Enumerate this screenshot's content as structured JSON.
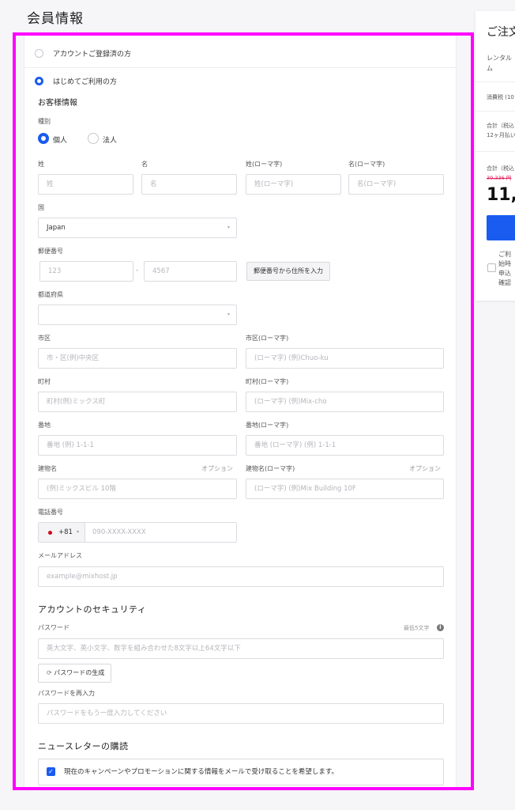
{
  "page_title": "会員情報",
  "account_options": {
    "registered": "アカウントご登録済の方",
    "first_time": "はじめてご利用の方"
  },
  "customer_section": "お客様情報",
  "type": {
    "label": "種別",
    "individual": "個人",
    "corporate": "法人",
    "selected": "個人"
  },
  "name": {
    "last_label": "姓",
    "last_placeholder": "姓",
    "first_label": "名",
    "first_placeholder": "名",
    "last_roman_label": "姓(ローマ字)",
    "last_roman_placeholder": "姓(ローマ字)",
    "first_roman_label": "名(ローマ字)",
    "first_roman_placeholder": "名(ローマ字)"
  },
  "country": {
    "label": "国",
    "value": "Japan"
  },
  "postal": {
    "label": "郵便番号",
    "part1_placeholder": "123",
    "separator": "-",
    "part2_placeholder": "4567",
    "lookup_button": "郵便番号から住所を入力"
  },
  "prefecture": {
    "label": "都道府県",
    "value": ""
  },
  "city": {
    "label": "市区",
    "placeholder": "市・区(例)中央区",
    "roman_label": "市区(ローマ字)",
    "roman_placeholder": "(ローマ字) (例)Chuo-ku"
  },
  "town": {
    "label": "町村",
    "placeholder": "町村(例)ミックス町",
    "roman_label": "町村(ローマ字)",
    "roman_placeholder": "(ローマ字) (例)Mix-cho"
  },
  "block": {
    "label": "番地",
    "placeholder": "番地 (例) 1-1-1",
    "roman_label": "番地(ローマ字)",
    "roman_placeholder": "番地 (ローマ字) (例) 1-1-1"
  },
  "building": {
    "label": "建物名",
    "optional": "オプション",
    "placeholder": "(例)ミックスビル 10階",
    "roman_label": "建物名(ローマ字)",
    "roman_optional": "オプション",
    "roman_placeholder": "(ローマ字) (例)Mix Building 10F"
  },
  "phone": {
    "label": "電話番号",
    "code": "+81",
    "placeholder": "090-XXXX-XXXX"
  },
  "email": {
    "label": "メールアドレス",
    "placeholder": "example@mixhost.jp"
  },
  "security": {
    "title": "アカウントのセキュリティ",
    "password_label": "パスワード",
    "min_hint": "最低5文字",
    "password_placeholder": "英大文字、英小文字、数字を組み合わせた8文字以上64文字以下",
    "generate_button": "パスワードの生成",
    "confirm_label": "パスワードを再入力",
    "confirm_placeholder": "パスワードをもう一度入力してください"
  },
  "newsletter": {
    "title": "ニュースレターの購読",
    "checkbox_label": "現在のキャンペーンやプロモーションに関する情報をメールで受け取ることを希望します。",
    "checked": true
  },
  "order": {
    "title": "ご注文",
    "rental_line1": "レンタル",
    "rental_line2": "ム",
    "tax": "消費税 (10",
    "total1": "合計（税込",
    "monthly": "12ヶ月払い",
    "total2": "合計（税込",
    "old_price": "39,336 円",
    "price": "11,",
    "note1": "ご利",
    "note2": "始時",
    "note3": "申込",
    "note4": "確認",
    "old_price_color": "#e0245e",
    "button_color": "#1a5cf0"
  },
  "colors": {
    "accent": "#1a5cf0",
    "highlight": "#ff00ff"
  }
}
